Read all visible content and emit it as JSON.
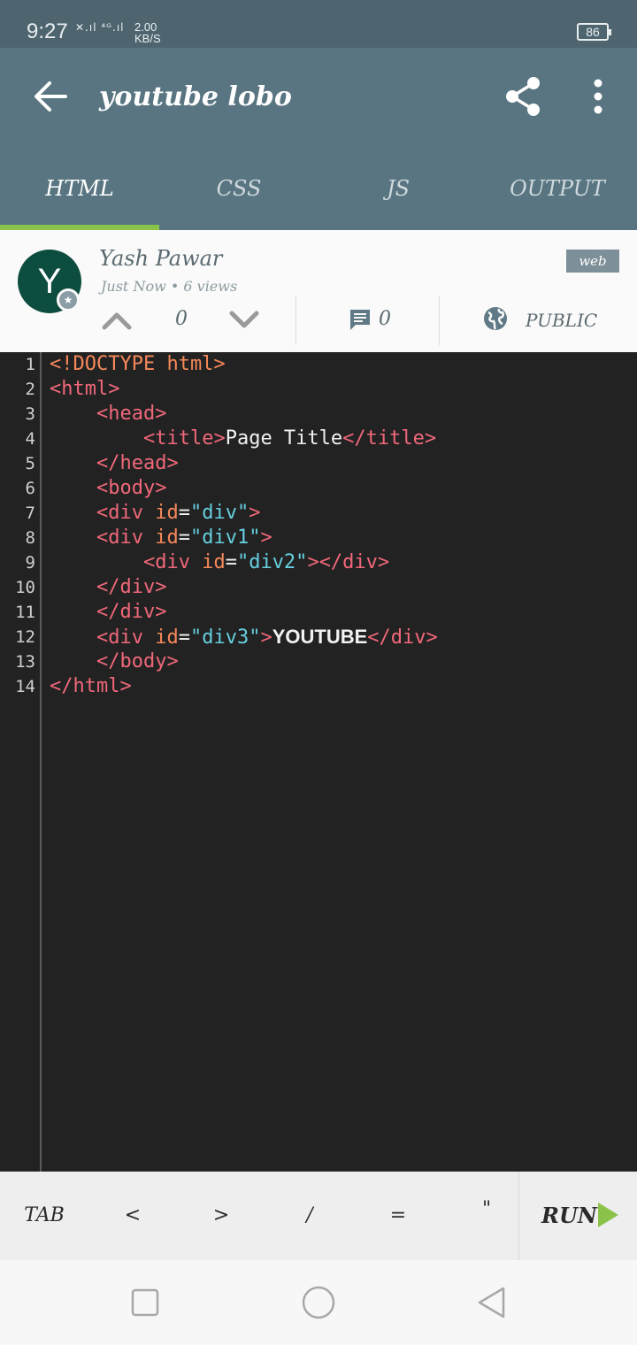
{
  "status": {
    "time": "9:27",
    "signal": "✕.ıl ⁴ᴳ.ıl",
    "speed_value": "2.00",
    "speed_unit": "KB/S",
    "battery": "86"
  },
  "app_bar": {
    "title": "youtube lobo",
    "tabs": [
      {
        "label": "HTML",
        "active": true
      },
      {
        "label": "CSS",
        "active": false
      },
      {
        "label": "JS",
        "active": false
      },
      {
        "label": "OUTPUT",
        "active": false
      }
    ],
    "accent_color": "#8bc34a"
  },
  "post": {
    "avatar_letter": "Y",
    "author": "Yash Pawar",
    "meta": "Just Now • 6 views",
    "tag": "web",
    "votes": "0",
    "comments": "0",
    "visibility": "PUBLIC"
  },
  "editor": {
    "line_numbers": [
      "1",
      "2",
      "3",
      "4",
      "5",
      "6",
      "7",
      "8",
      "9",
      "10",
      "11",
      "12",
      "13",
      "14"
    ],
    "lines": [
      "<!DOCTYPE html>",
      "<html>",
      "    <head>",
      "        <title>Page Title</title>",
      "    </head>",
      "    <body>",
      "    <div id=\"div\">",
      "    <div id=\"div1\">",
      "        <div id=\"div2\"></div>",
      "    </div>",
      "    </div>",
      "    <div id=\"div3\">YOUTUBE</div>",
      "    </body>",
      "</html>"
    ]
  },
  "keybar": {
    "keys": [
      "TAB",
      "<",
      ">",
      "/",
      "=",
      "\""
    ],
    "run_label": "RUN"
  },
  "navbar": {
    "icons": [
      "recent-apps-icon",
      "home-icon",
      "back-icon"
    ]
  }
}
